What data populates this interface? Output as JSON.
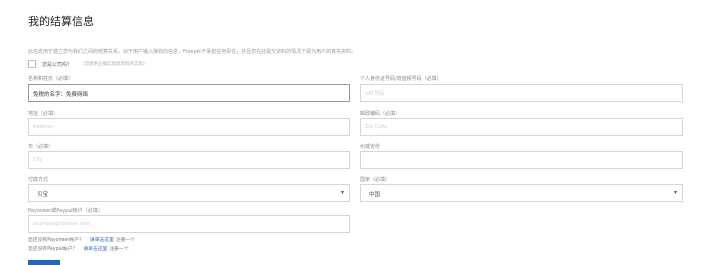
{
  "page": {
    "title": "我的结算信息",
    "description": "此信息用于建立您与我们之间的结算关系。对于用户输入接收的信息，Freepik不承担任何责任，并且您在此提交资料的情况下视为用户的真实资料。"
  },
  "company": {
    "label": "您是公司吗？",
    "hint": "（您提供正确实现您资料的实际）"
  },
  "fields": {
    "name": {
      "label": "名称和姓氏（必填）",
      "value": "免税的名字：免费网络"
    },
    "vat": {
      "label": "个人身份证号码/增值税号码（必填）",
      "placeholder": "VAT号码"
    },
    "address": {
      "label": "地址（必填）",
      "placeholder": "Address"
    },
    "postal": {
      "label": "邮政编码（必填）",
      "placeholder": "Zip Code"
    },
    "city": {
      "label": "市（必填）",
      "placeholder": "City"
    },
    "state": {
      "label": "州或省份",
      "placeholder": ""
    },
    "method": {
      "label": "付款方式",
      "value": "贝宝"
    },
    "country": {
      "label": "国家（必填）",
      "value": "中国"
    },
    "payoneer": {
      "label": "Payoneer或Paypal帐户（必填）",
      "placeholder": "example@domain.com"
    }
  },
  "footer": {
    "line1_text": "您还没有Payoneer帐户？",
    "line1_link": "请单击这里",
    "line1_rest": "注册一个",
    "line2_text": "您还没有Paypal帐户？",
    "line2_link": "请单击这里",
    "line2_rest": "注册一个"
  },
  "icons": {
    "dropdown": "chevron-down-icon"
  },
  "colors": {
    "link": "#2c66c6",
    "button": "#1e67c8"
  }
}
